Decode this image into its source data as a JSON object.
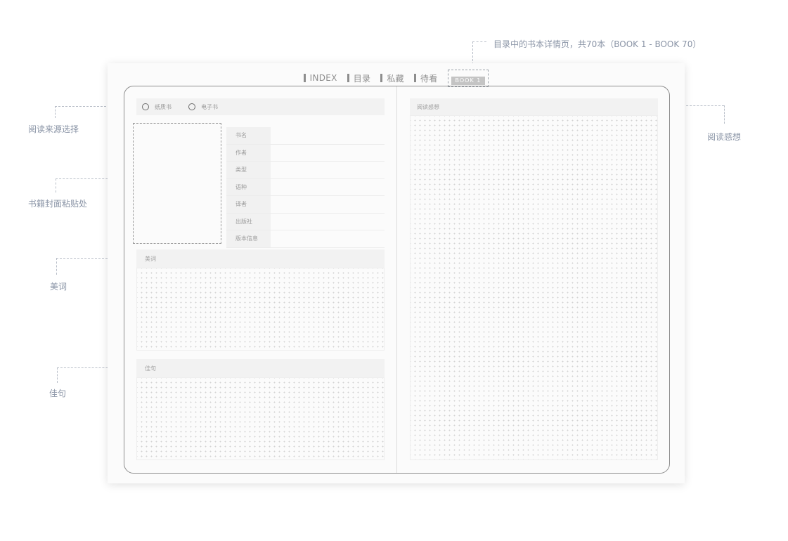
{
  "annotations": {
    "source_select": "阅读来源选择",
    "cover_paste": "书籍封面粘贴处",
    "beautiful_words": "美词",
    "good_sentences": "佳句",
    "reflection": "阅读感想",
    "top_note": "目录中的书本详情页，共70本（BOOK  1 - BOOK  70）"
  },
  "nav": {
    "items": [
      "INDEX",
      "目录",
      "私藏",
      "待看"
    ],
    "active": "BOOK  1"
  },
  "source_options": [
    "纸质书",
    "电子书"
  ],
  "info_fields": [
    "书名",
    "作者",
    "类型",
    "语种",
    "译者",
    "出版社",
    "版本信息"
  ],
  "sections": {
    "beautiful_words": "美词",
    "good_sentences": "佳句",
    "reflection": "阅读感想"
  }
}
